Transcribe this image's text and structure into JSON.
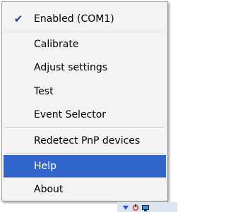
{
  "menu": {
    "items": [
      {
        "label": "Enabled  (COM1)",
        "checked": true
      },
      {
        "label": "Calibrate"
      },
      {
        "label": "Adjust settings"
      },
      {
        "label": "Test"
      },
      {
        "label": "Event Selector"
      },
      {
        "label": "Redetect PnP devices"
      },
      {
        "label": "Help",
        "highlighted": true
      },
      {
        "label": "About"
      }
    ],
    "check_glyph": "✔"
  },
  "colors": {
    "menu_background": "#f3f3f3",
    "highlight": "#3366cc",
    "highlight_text": "#ffffff",
    "text": "#000000",
    "check": "#1d3f8f"
  },
  "tray": {
    "icons": [
      "network-down-icon",
      "tool-icon",
      "monitor-icon"
    ]
  }
}
